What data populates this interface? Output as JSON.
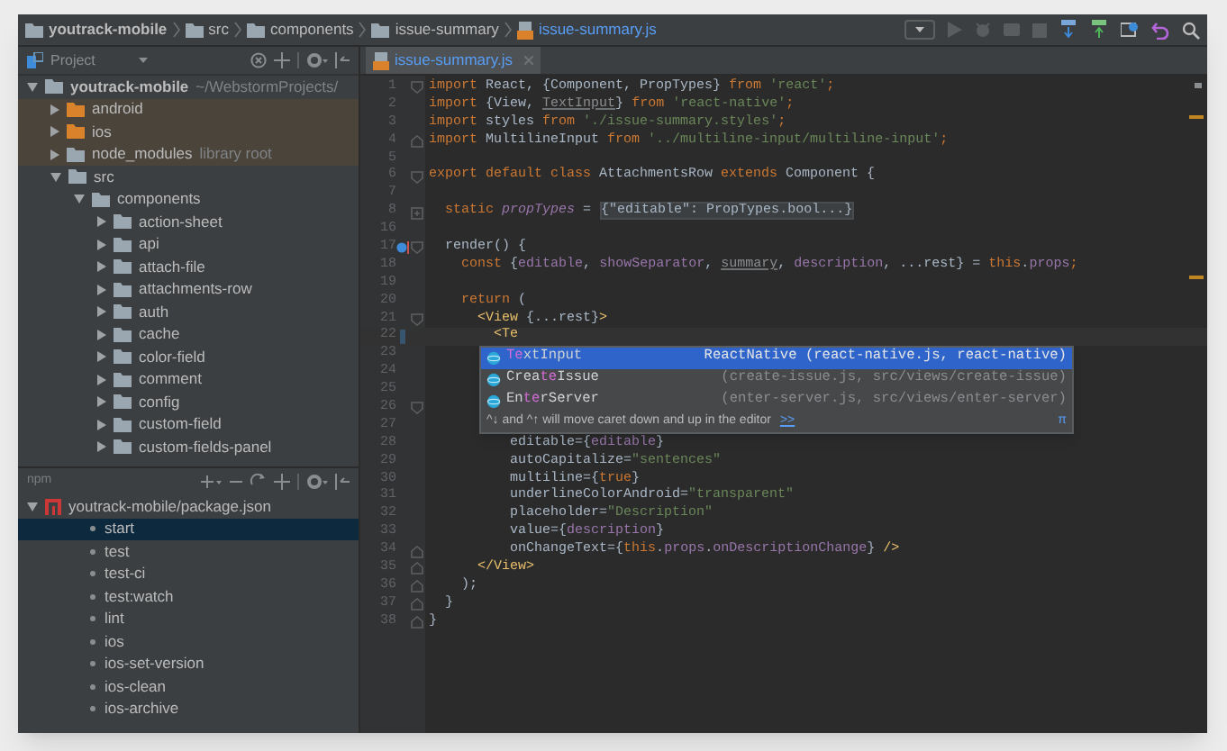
{
  "breadcrumbs": [
    {
      "label": "youtrack-mobile",
      "kind": "module"
    },
    {
      "label": "src",
      "kind": "folder"
    },
    {
      "label": "components",
      "kind": "folder"
    },
    {
      "label": "issue-summary",
      "kind": "folder"
    },
    {
      "label": "issue-summary.js",
      "kind": "file"
    }
  ],
  "project_panel": {
    "title": "Project",
    "tree": [
      {
        "label": "youtrack-mobile",
        "hint": "~/WebstormProjects/",
        "kind": "module",
        "expanded": true,
        "children": [
          {
            "label": "android",
            "kind": "excluded",
            "expanded": false
          },
          {
            "label": "ios",
            "kind": "excluded",
            "expanded": false
          },
          {
            "label": "node_modules",
            "hint": "library root",
            "kind": "library",
            "expanded": false
          },
          {
            "label": "src",
            "kind": "folder",
            "expanded": true,
            "children": [
              {
                "label": "components",
                "kind": "folder",
                "expanded": true,
                "children": [
                  {
                    "label": "action-sheet",
                    "kind": "folder",
                    "expanded": false
                  },
                  {
                    "label": "api",
                    "kind": "folder",
                    "expanded": false
                  },
                  {
                    "label": "attach-file",
                    "kind": "folder",
                    "expanded": false
                  },
                  {
                    "label": "attachments-row",
                    "kind": "folder",
                    "expanded": false
                  },
                  {
                    "label": "auth",
                    "kind": "folder",
                    "expanded": false
                  },
                  {
                    "label": "cache",
                    "kind": "folder",
                    "expanded": false
                  },
                  {
                    "label": "color-field",
                    "kind": "folder",
                    "expanded": false
                  },
                  {
                    "label": "comment",
                    "kind": "folder",
                    "expanded": false
                  },
                  {
                    "label": "config",
                    "kind": "folder",
                    "expanded": false
                  },
                  {
                    "label": "custom-field",
                    "kind": "folder",
                    "expanded": false
                  },
                  {
                    "label": "custom-fields-panel",
                    "kind": "folder",
                    "expanded": false
                  }
                ]
              }
            ]
          }
        ]
      }
    ]
  },
  "npm_panel": {
    "title": "npm",
    "tree": [
      {
        "label": "youtrack-mobile/package.json",
        "expanded": true,
        "children": [
          {
            "label": "start",
            "selected": true
          },
          {
            "label": "test",
            "selected": false
          },
          {
            "label": "test-ci",
            "selected": false
          },
          {
            "label": "test:watch",
            "selected": false
          },
          {
            "label": "lint",
            "selected": false
          },
          {
            "label": "ios",
            "selected": false
          },
          {
            "label": "ios-set-version",
            "selected": false
          },
          {
            "label": "ios-clean",
            "selected": false
          },
          {
            "label": "ios-archive",
            "selected": false
          }
        ]
      }
    ]
  },
  "editor_tabs": [
    {
      "label": "issue-summary.js",
      "selected": true
    }
  ],
  "code_lines": [
    {
      "number": "1",
      "gutter": [
        {
          "kind": "fold-start"
        }
      ],
      "current": false,
      "tokens": [
        {
          "kind": "keyword",
          "text": "import "
        },
        {
          "kind": "plain",
          "text": "React, {Component, PropTypes} "
        },
        {
          "kind": "keyword",
          "text": "from "
        },
        {
          "kind": "string",
          "text": "'react'"
        },
        {
          "kind": "keyword",
          "text": ";"
        }
      ]
    },
    {
      "number": "2",
      "current": false,
      "tokens": [
        {
          "kind": "keyword",
          "text": "import "
        },
        {
          "kind": "plain",
          "text": "{View, "
        },
        {
          "kind": "unused",
          "text": "TextInput"
        },
        {
          "kind": "plain",
          "text": "} "
        },
        {
          "kind": "keyword",
          "text": "from "
        },
        {
          "kind": "string",
          "text": "'react-native'"
        },
        {
          "kind": "keyword",
          "text": ";"
        }
      ]
    },
    {
      "number": "3",
      "current": false,
      "tokens": [
        {
          "kind": "keyword",
          "text": "import "
        },
        {
          "kind": "plain",
          "text": "styles "
        },
        {
          "kind": "keyword",
          "text": "from "
        },
        {
          "kind": "string",
          "text": "'./issue-summary.styles'"
        },
        {
          "kind": "keyword",
          "text": ";"
        }
      ]
    },
    {
      "number": "4",
      "gutter": [
        {
          "kind": "fold-end"
        }
      ],
      "current": false,
      "tokens": [
        {
          "kind": "keyword",
          "text": "import "
        },
        {
          "kind": "plain",
          "text": "MultilineInput "
        },
        {
          "kind": "keyword",
          "text": "from "
        },
        {
          "kind": "string",
          "text": "'../multiline-input/multiline-input'"
        },
        {
          "kind": "keyword",
          "text": ";"
        }
      ]
    },
    {
      "number": "5",
      "current": false
    },
    {
      "number": "6",
      "gutter": [
        {
          "kind": "fold-start"
        }
      ],
      "current": false,
      "tokens": [
        {
          "kind": "keyword",
          "text": "export default class "
        },
        {
          "kind": "plain",
          "text": "AttachmentsRow "
        },
        {
          "kind": "keyword",
          "text": "extends "
        },
        {
          "kind": "plain",
          "text": "Component {"
        }
      ]
    },
    {
      "number": "7",
      "current": false
    },
    {
      "number": "8",
      "gutter": [
        {
          "kind": "fold-collapsed"
        }
      ],
      "current": false,
      "tokens": [
        {
          "kind": "keyword",
          "text": "  static "
        },
        {
          "kind": "static-field",
          "text": "propTypes"
        },
        {
          "kind": "plain",
          "text": " = "
        },
        {
          "kind": "folded",
          "text": "{\"editable\": PropTypes.bool...}"
        }
      ]
    },
    {
      "number": "16",
      "current": false
    },
    {
      "number": "17",
      "gutter": [
        {
          "kind": "method"
        },
        {
          "kind": "fold-start"
        }
      ],
      "current": false,
      "tokens": [
        {
          "kind": "plain",
          "text": "  render() {"
        }
      ]
    },
    {
      "number": "18",
      "current": false,
      "tokens": [
        {
          "kind": "keyword",
          "text": "    const "
        },
        {
          "kind": "plain",
          "text": "{"
        },
        {
          "kind": "field",
          "text": "editable"
        },
        {
          "kind": "plain",
          "text": ", "
        },
        {
          "kind": "field",
          "text": "showSeparator"
        },
        {
          "kind": "plain",
          "text": ", "
        },
        {
          "kind": "unused",
          "text": "summary"
        },
        {
          "kind": "plain",
          "text": ", "
        },
        {
          "kind": "field",
          "text": "description"
        },
        {
          "kind": "plain",
          "text": ", ...rest} = "
        },
        {
          "kind": "keyword",
          "text": "this"
        },
        {
          "kind": "plain",
          "text": "."
        },
        {
          "kind": "field",
          "text": "props"
        },
        {
          "kind": "keyword",
          "text": ";"
        }
      ]
    },
    {
      "number": "19",
      "current": false
    },
    {
      "number": "20",
      "current": false,
      "tokens": [
        {
          "kind": "keyword",
          "text": "    return"
        },
        {
          "kind": "plain",
          "text": " ("
        }
      ]
    },
    {
      "number": "21",
      "gutter": [
        {
          "kind": "fold-start"
        }
      ],
      "current": false,
      "tokens": [
        {
          "kind": "tag",
          "text": "      <View"
        },
        {
          "kind": "plain",
          "text": " {...rest}"
        },
        {
          "kind": "tag",
          "text": ">"
        }
      ]
    },
    {
      "number": "22",
      "current": true,
      "tokens": [
        {
          "kind": "tag",
          "text": "        <Te"
        }
      ]
    },
    {
      "number": "23",
      "current": false
    },
    {
      "number": "24",
      "current": false
    },
    {
      "number": "25",
      "current": false
    },
    {
      "number": "26",
      "gutter": [
        {
          "kind": "fold-start"
        }
      ],
      "current": false
    },
    {
      "number": "27",
      "current": false
    },
    {
      "number": "28",
      "current": false,
      "tokens": [
        {
          "kind": "plain",
          "text": "          editable={"
        },
        {
          "kind": "field",
          "text": "editable"
        },
        {
          "kind": "plain",
          "text": "}"
        }
      ]
    },
    {
      "number": "29",
      "current": false,
      "tokens": [
        {
          "kind": "plain",
          "text": "          autoCapitalize="
        },
        {
          "kind": "string",
          "text": "\"sentences\""
        }
      ]
    },
    {
      "number": "30",
      "current": false,
      "tokens": [
        {
          "kind": "plain",
          "text": "          multiline={"
        },
        {
          "kind": "keyword",
          "text": "true"
        },
        {
          "kind": "plain",
          "text": "}"
        }
      ]
    },
    {
      "number": "31",
      "current": false,
      "tokens": [
        {
          "kind": "plain",
          "text": "          underlineColorAndroid="
        },
        {
          "kind": "string",
          "text": "\"transparent\""
        }
      ]
    },
    {
      "number": "32",
      "current": false,
      "tokens": [
        {
          "kind": "plain",
          "text": "          placeholder="
        },
        {
          "kind": "string",
          "text": "\"Description\""
        }
      ]
    },
    {
      "number": "33",
      "current": false,
      "tokens": [
        {
          "kind": "plain",
          "text": "          value={"
        },
        {
          "kind": "field",
          "text": "description"
        },
        {
          "kind": "plain",
          "text": "}"
        }
      ]
    },
    {
      "number": "34",
      "gutter": [
        {
          "kind": "fold-end"
        }
      ],
      "current": false,
      "tokens": [
        {
          "kind": "plain",
          "text": "          onChangeText={"
        },
        {
          "kind": "keyword",
          "text": "this"
        },
        {
          "kind": "plain",
          "text": "."
        },
        {
          "kind": "field",
          "text": "props"
        },
        {
          "kind": "plain",
          "text": "."
        },
        {
          "kind": "field",
          "text": "onDescriptionChange"
        },
        {
          "kind": "plain",
          "text": "} "
        },
        {
          "kind": "tag",
          "text": "/>"
        }
      ]
    },
    {
      "number": "35",
      "gutter": [
        {
          "kind": "fold-end"
        }
      ],
      "current": false,
      "tokens": [
        {
          "kind": "tag",
          "text": "      </View>"
        }
      ]
    },
    {
      "number": "36",
      "gutter": [
        {
          "kind": "fold-end"
        }
      ],
      "current": false,
      "tokens": [
        {
          "kind": "plain",
          "text": "    );"
        }
      ]
    },
    {
      "number": "37",
      "gutter": [
        {
          "kind": "fold-end"
        }
      ],
      "current": false,
      "tokens": [
        {
          "kind": "plain",
          "text": "  }"
        }
      ]
    },
    {
      "number": "38",
      "gutter": [
        {
          "kind": "fold-end"
        }
      ],
      "current": false,
      "tokens": [
        {
          "kind": "plain",
          "text": "}"
        }
      ]
    }
  ],
  "completion": {
    "items": [
      {
        "match": "Te",
        "after": "xtInput",
        "location": "ReactNative (react-native.js, react-native)",
        "selected": true
      },
      {
        "before": "Crea",
        "match": "te",
        "after": "Issue",
        "location": "(create-issue.js, src/views/create-issue)",
        "selected": false
      },
      {
        "before": "En",
        "match": "te",
        "after": "rServer",
        "location": "(enter-server.js, src/views/enter-server)",
        "selected": false
      }
    ],
    "hint": "^↓ and ^↑ will move caret down and up in the editor",
    "more_link": ">>",
    "pi": "π"
  }
}
